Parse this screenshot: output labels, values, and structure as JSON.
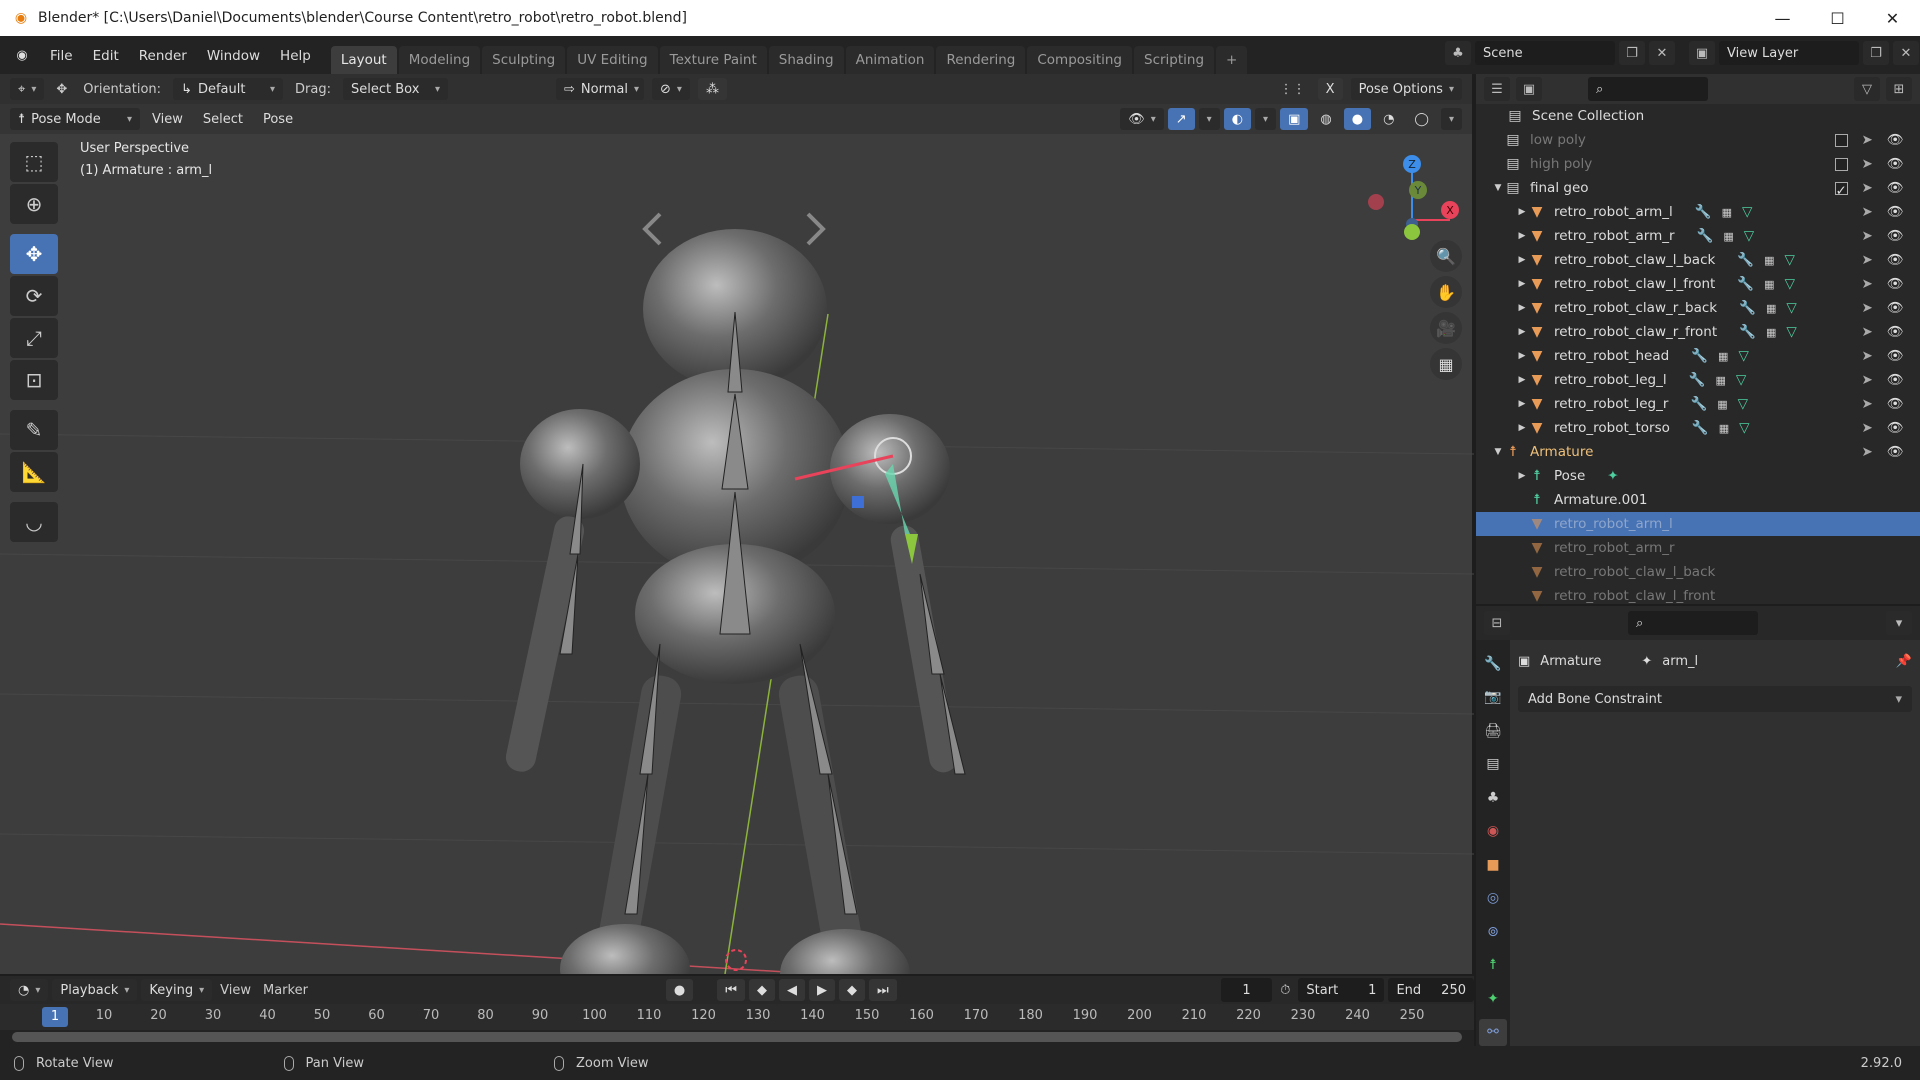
{
  "window": {
    "title": "Blender* [C:\\Users\\Daniel\\Documents\\blender\\Course Content\\retro_robot\\retro_robot.blend]",
    "controls": [
      "—",
      "☐",
      "✕"
    ]
  },
  "menu": [
    "File",
    "Edit",
    "Render",
    "Window",
    "Help"
  ],
  "workspaces": [
    {
      "label": "Layout",
      "active": true
    },
    {
      "label": "Modeling"
    },
    {
      "label": "Sculpting"
    },
    {
      "label": "UV Editing"
    },
    {
      "label": "Texture Paint"
    },
    {
      "label": "Shading"
    },
    {
      "label": "Animation"
    },
    {
      "label": "Rendering"
    },
    {
      "label": "Compositing"
    },
    {
      "label": "Scripting"
    }
  ],
  "add_workspace": "+",
  "scene": {
    "name": "Scene",
    "view_layer": "View Layer"
  },
  "viewport": {
    "orientation_label": "Orientation:",
    "orientation_value": "Default",
    "drag_label": "Drag:",
    "drag_value": "Select Box",
    "pivot_value": "Normal",
    "pose_options": "Pose Options",
    "mode": "Pose Mode",
    "menus": [
      "View",
      "Select",
      "Pose"
    ],
    "info_line1": "User Perspective",
    "info_line2": "(1) Armature : arm_l",
    "gizmo": {
      "x": "X",
      "y": "Y",
      "z": "Z"
    },
    "colors": {
      "x": "#e8435a",
      "y": "#8cc63f",
      "z": "#3d8eea",
      "accent": "#4772b3"
    }
  },
  "outliner": {
    "root": "Scene Collection",
    "rows": [
      {
        "label": "low poly",
        "type": "collection",
        "dim": true
      },
      {
        "label": "high poly",
        "type": "collection",
        "dim": true
      },
      {
        "label": "final geo",
        "type": "collection",
        "expanded": true
      },
      {
        "label": "retro_robot_arm_l",
        "type": "mesh"
      },
      {
        "label": "retro_robot_arm_r",
        "type": "mesh"
      },
      {
        "label": "retro_robot_claw_l_back",
        "type": "mesh"
      },
      {
        "label": "retro_robot_claw_l_front",
        "type": "mesh"
      },
      {
        "label": "retro_robot_claw_r_back",
        "type": "mesh"
      },
      {
        "label": "retro_robot_claw_r_front",
        "type": "mesh"
      },
      {
        "label": "retro_robot_head",
        "type": "mesh"
      },
      {
        "label": "retro_robot_leg_l",
        "type": "mesh"
      },
      {
        "label": "retro_robot_leg_r",
        "type": "mesh"
      },
      {
        "label": "retro_robot_torso",
        "type": "mesh"
      },
      {
        "label": "Armature",
        "type": "armature"
      },
      {
        "label": "Pose",
        "type": "pose"
      },
      {
        "label": "Armature.001",
        "type": "armdata"
      },
      {
        "label": "retro_robot_arm_l",
        "type": "child",
        "selected": true
      },
      {
        "label": "retro_robot_arm_r",
        "type": "child"
      },
      {
        "label": "retro_robot_claw_l_back",
        "type": "child"
      },
      {
        "label": "retro_robot_claw_l_front",
        "type": "child"
      }
    ]
  },
  "properties": {
    "object": "Armature",
    "bone": "arm_l",
    "add_constraint": "Add Bone Constraint"
  },
  "timeline": {
    "menus": [
      "Playback",
      "Keying",
      "View",
      "Marker"
    ],
    "current_frame": "1",
    "start_label": "Start",
    "start": "1",
    "end_label": "End",
    "end": "250",
    "ticks": [
      "10",
      "20",
      "30",
      "40",
      "50",
      "60",
      "70",
      "80",
      "90",
      "100",
      "110",
      "120",
      "130",
      "140",
      "150",
      "160",
      "170",
      "180",
      "190",
      "200",
      "210",
      "220",
      "230",
      "240",
      "250"
    ]
  },
  "status": {
    "rotate": "Rotate View",
    "pan": "Pan View",
    "zoom": "Zoom View",
    "version": "2.92.0"
  }
}
